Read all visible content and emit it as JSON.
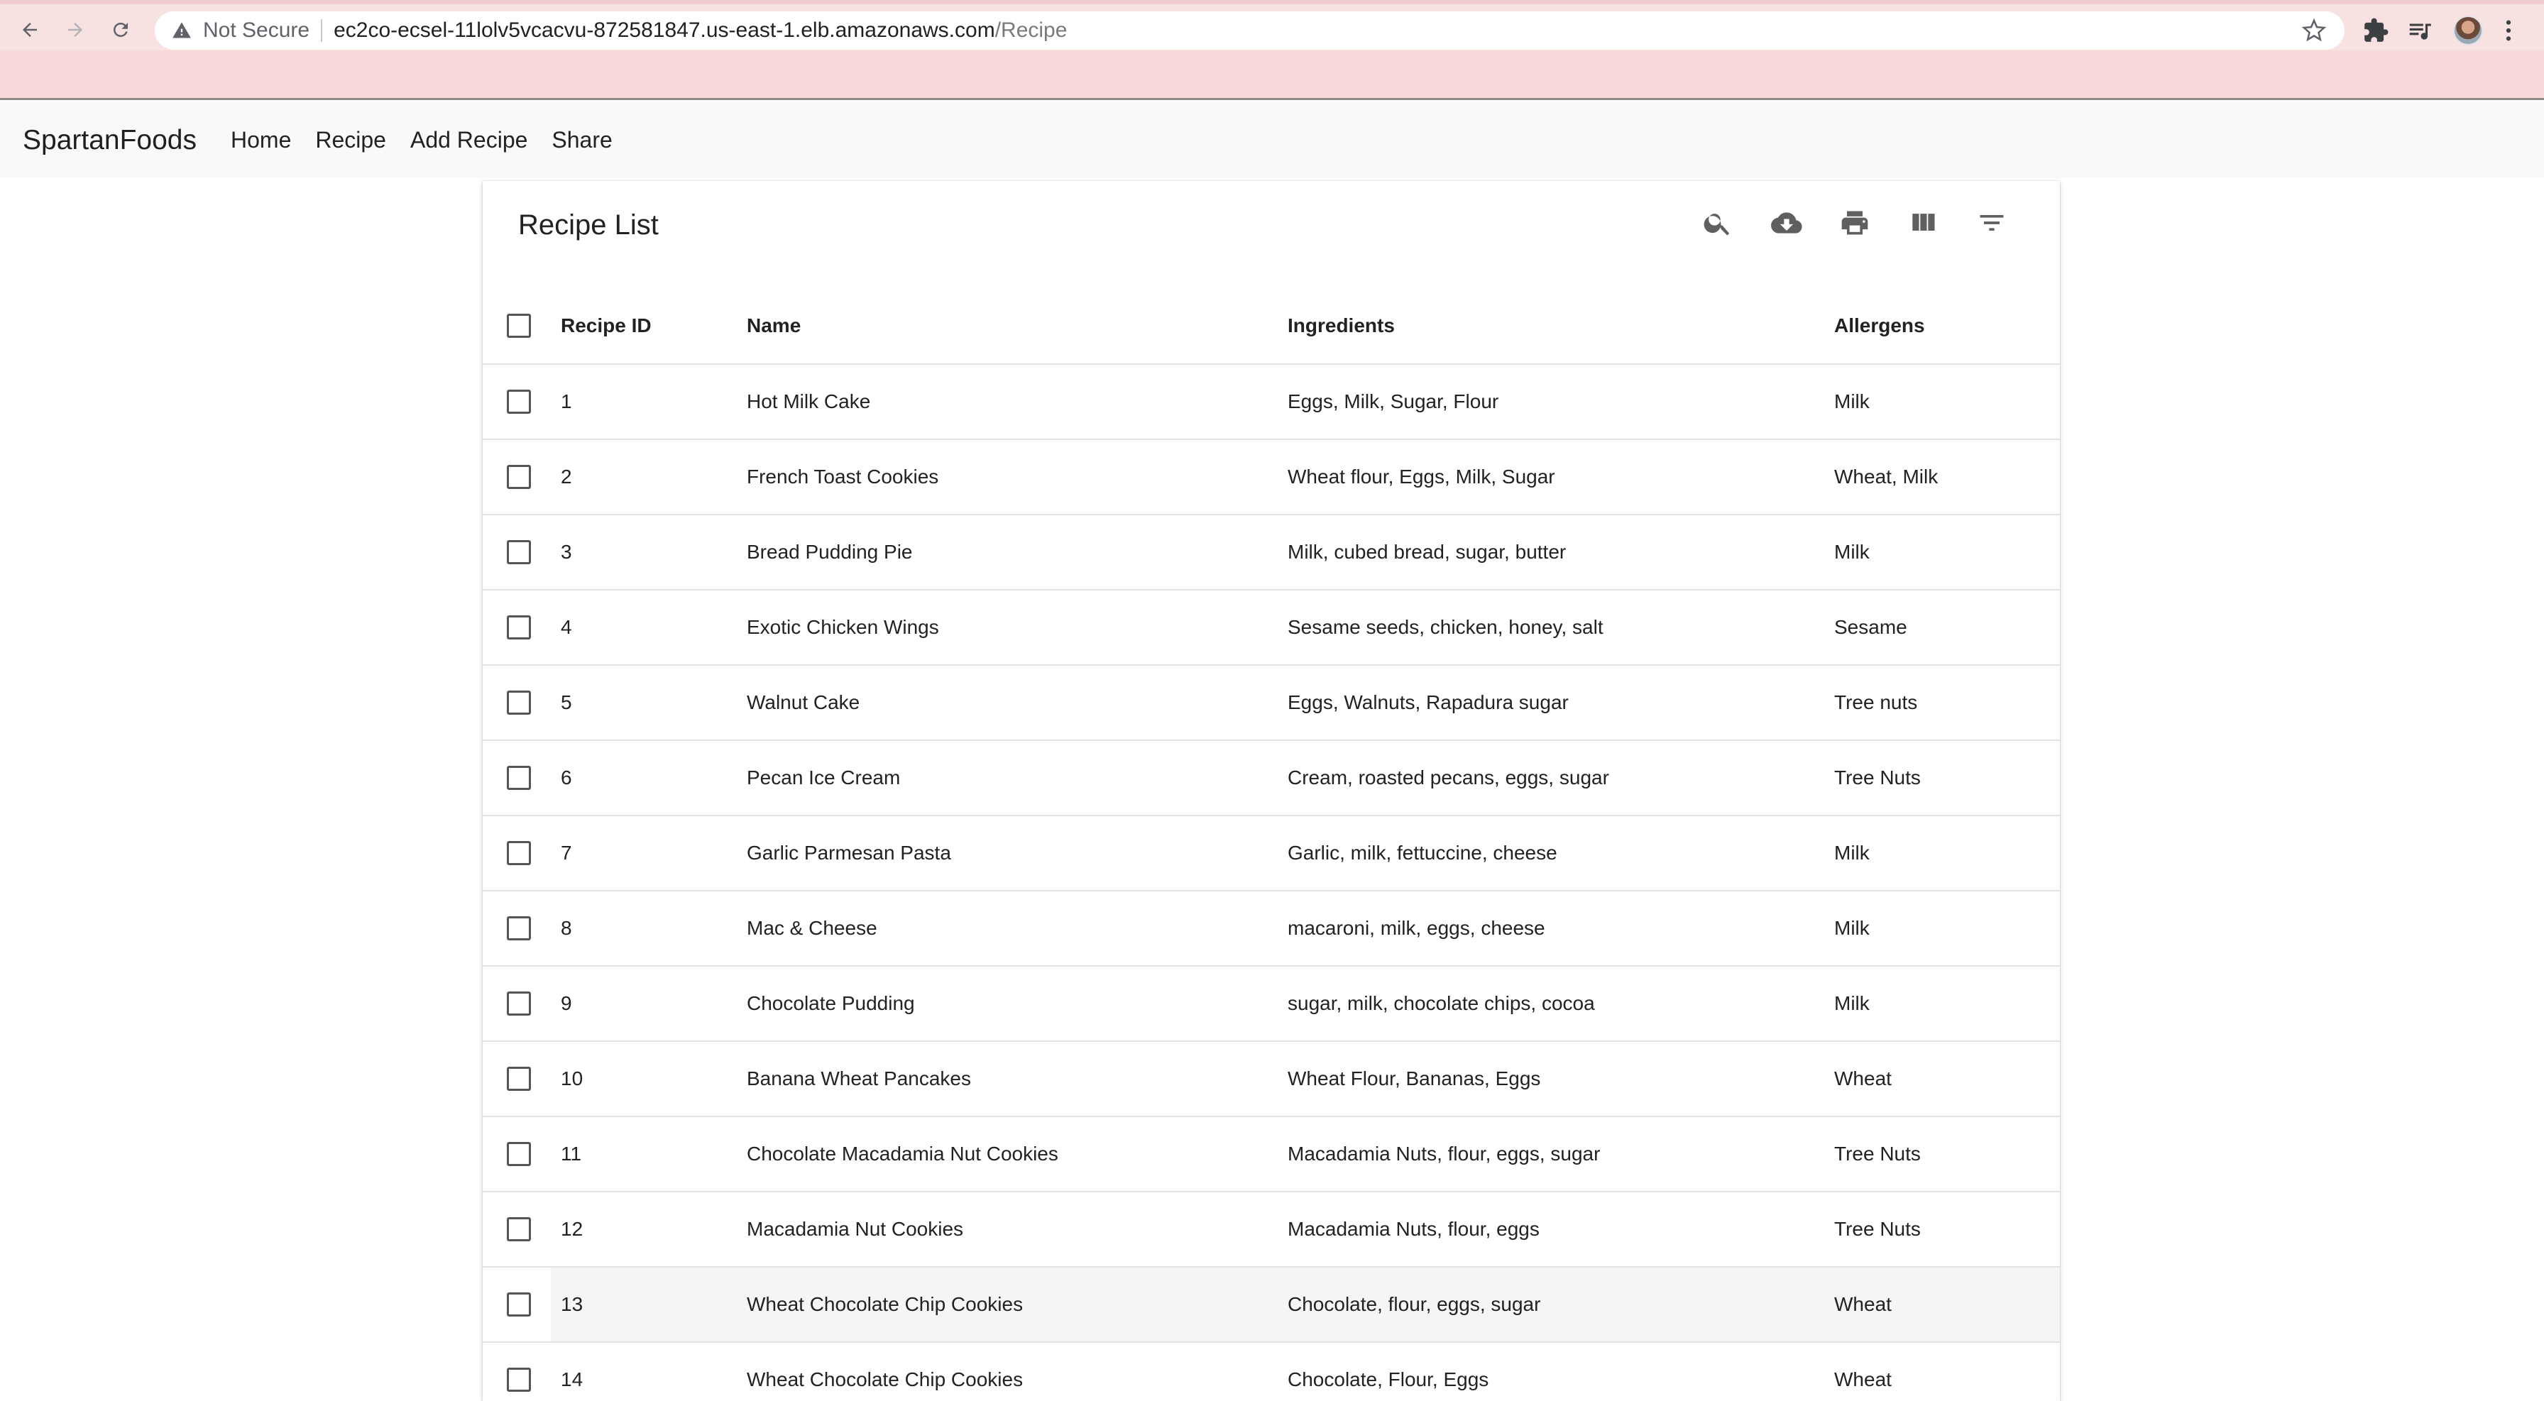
{
  "browser": {
    "security_label": "Not Secure",
    "url_host": "ec2co-ecsel-11lolv5vcacvu-872581847.us-east-1.elb.amazonaws.com",
    "url_path": "/Recipe"
  },
  "navbar": {
    "brand": "SpartanFoods",
    "links": [
      "Home",
      "Recipe",
      "Add Recipe",
      "Share"
    ]
  },
  "table": {
    "title": "Recipe List",
    "toolbar_icons": [
      "search-icon",
      "cloud-download-icon",
      "print-icon",
      "view-column-icon",
      "filter-list-icon"
    ],
    "columns": [
      "Recipe ID",
      "Name",
      "Ingredients",
      "Allergens"
    ],
    "rows": [
      {
        "id": "1",
        "name": "Hot Milk Cake",
        "ingredients": "Eggs, Milk, Sugar, Flour",
        "allergens": "Milk"
      },
      {
        "id": "2",
        "name": "French Toast Cookies",
        "ingredients": "Wheat flour, Eggs, Milk, Sugar",
        "allergens": "Wheat, Milk"
      },
      {
        "id": "3",
        "name": "Bread Pudding Pie",
        "ingredients": "Milk, cubed bread, sugar, butter",
        "allergens": "Milk"
      },
      {
        "id": "4",
        "name": "Exotic Chicken Wings",
        "ingredients": "Sesame seeds, chicken, honey, salt",
        "allergens": "Sesame"
      },
      {
        "id": "5",
        "name": "Walnut Cake",
        "ingredients": "Eggs, Walnuts, Rapadura sugar",
        "allergens": "Tree nuts"
      },
      {
        "id": "6",
        "name": "Pecan Ice Cream",
        "ingredients": "Cream, roasted pecans, eggs, sugar",
        "allergens": "Tree Nuts"
      },
      {
        "id": "7",
        "name": "Garlic Parmesan Pasta",
        "ingredients": "Garlic, milk, fettuccine, cheese",
        "allergens": "Milk"
      },
      {
        "id": "8",
        "name": "Mac & Cheese",
        "ingredients": "macaroni, milk, eggs, cheese",
        "allergens": "Milk"
      },
      {
        "id": "9",
        "name": "Chocolate Pudding",
        "ingredients": "sugar, milk, chocolate chips, cocoa",
        "allergens": "Milk"
      },
      {
        "id": "10",
        "name": "Banana Wheat Pancakes",
        "ingredients": "Wheat Flour, Bananas, Eggs",
        "allergens": "Wheat"
      },
      {
        "id": "11",
        "name": "Chocolate Macadamia Nut Cookies",
        "ingredients": "Macadamia Nuts, flour, eggs, sugar",
        "allergens": "Tree Nuts"
      },
      {
        "id": "12",
        "name": "Macadamia Nut Cookies",
        "ingredients": "Macadamia Nuts, flour, eggs",
        "allergens": "Tree Nuts"
      },
      {
        "id": "13",
        "name": "Wheat Chocolate Chip Cookies",
        "ingredients": "Chocolate, flour, eggs, sugar",
        "allergens": "Wheat"
      },
      {
        "id": "14",
        "name": "Wheat Chocolate Chip Cookies",
        "ingredients": "Chocolate, Flour, Eggs",
        "allergens": "Wheat"
      }
    ]
  },
  "colors": {
    "banner": "#f8d9d9",
    "navbar_bg": "#f8f9fa",
    "icon_gray": "#5f5f5f"
  }
}
